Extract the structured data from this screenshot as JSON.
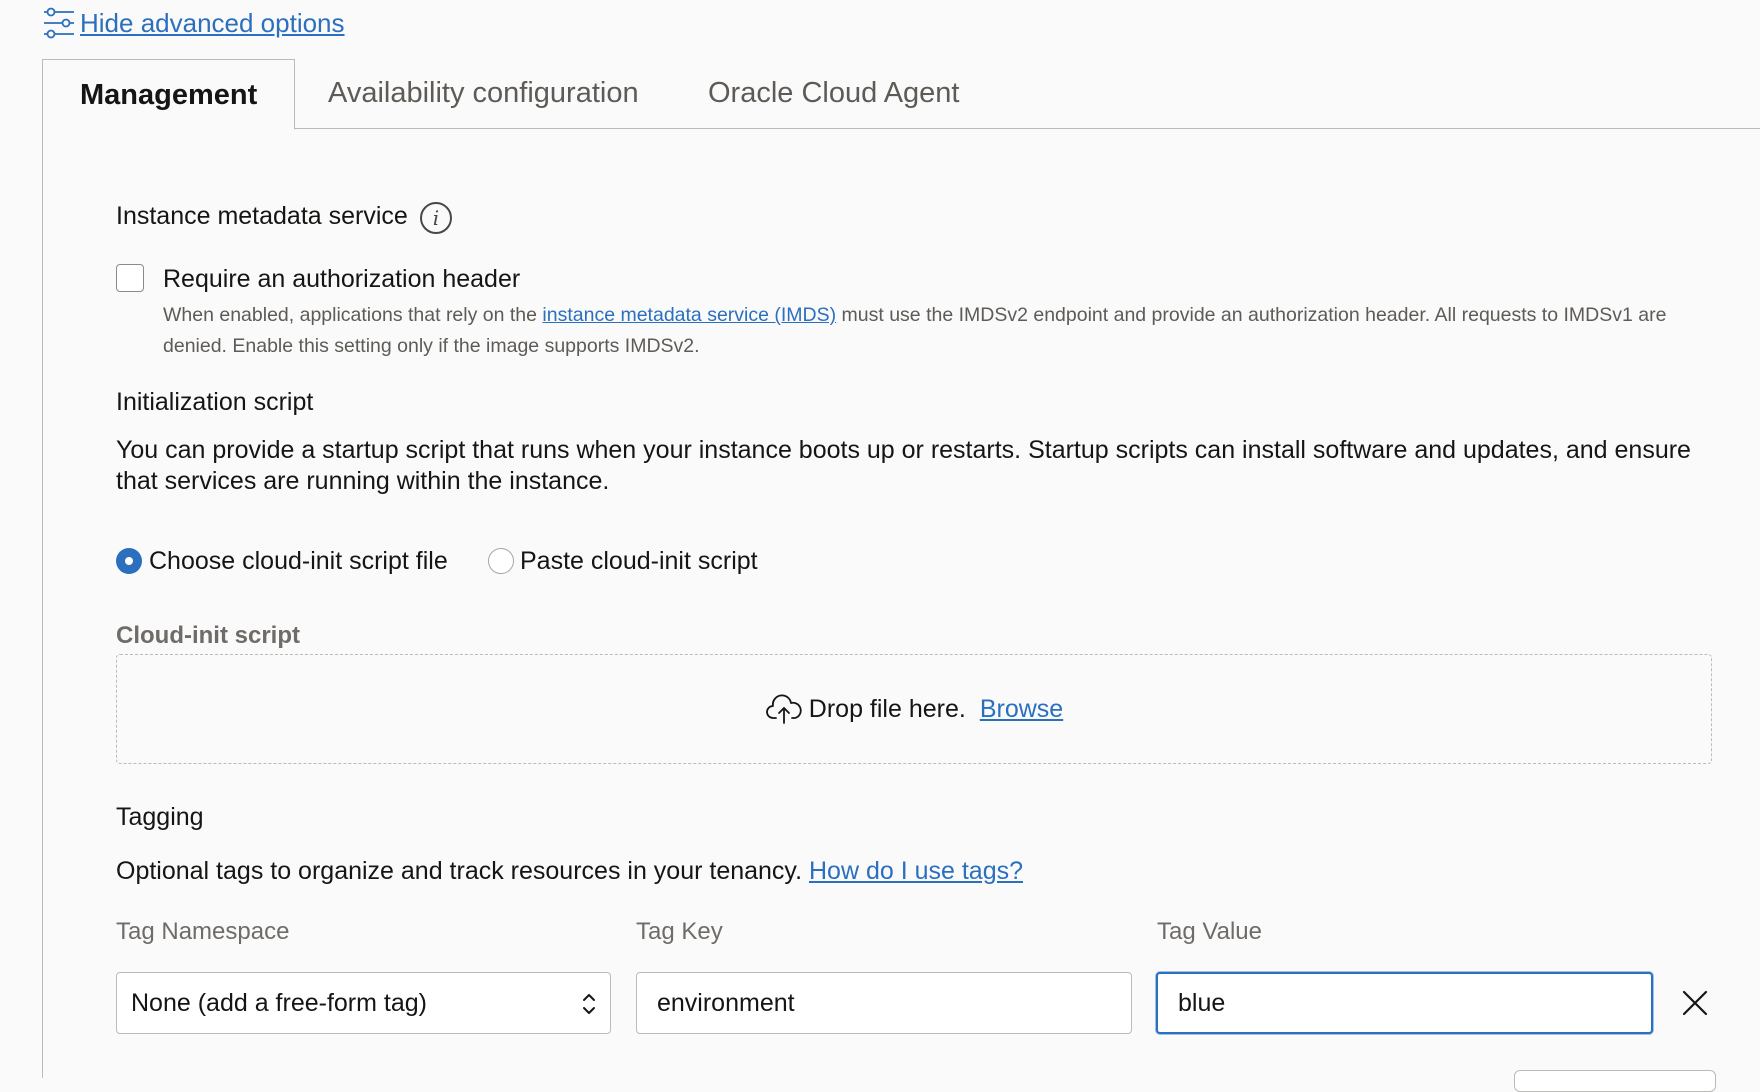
{
  "advanced_link": "Hide advanced options",
  "tabs": [
    {
      "label": "Management",
      "active": true
    },
    {
      "label": "Availability configuration",
      "active": false
    },
    {
      "label": "Oracle Cloud Agent",
      "active": false
    }
  ],
  "imds": {
    "title": "Instance metadata service",
    "info_icon": "i",
    "checkbox_label": "Require an authorization header",
    "checked": false,
    "help_before": "When enabled, applications that rely on the ",
    "help_link": "instance metadata service (IMDS)",
    "help_after": " must use the IMDSv2 endpoint and provide an authorization header. All requests to IMDSv1 are denied. Enable this setting only if the image supports IMDSv2."
  },
  "init_script": {
    "title": "Initialization script",
    "description": "You can provide a startup script that runs when your instance boots up or restarts. Startup scripts can install software and updates, and ensure that services are running within the instance.",
    "options": [
      {
        "label": "Choose cloud-init script file",
        "selected": true
      },
      {
        "label": "Paste cloud-init script",
        "selected": false
      }
    ],
    "field_label": "Cloud-init script",
    "drop_text": "Drop file here.",
    "browse_link": "Browse"
  },
  "tagging": {
    "title": "Tagging",
    "description": "Optional tags to organize and track resources in your tenancy.",
    "help_link": "How do I use tags?",
    "namespace_label": "Tag Namespace",
    "key_label": "Tag Key",
    "value_label": "Tag Value",
    "namespace_value": "None (add a free-form tag)",
    "key_value": "environment",
    "value_value": "blue"
  },
  "colors": {
    "accent": "#2b6fbf",
    "text": "#161513",
    "muted": "#5e5b57",
    "border": "#bdbbb8"
  }
}
